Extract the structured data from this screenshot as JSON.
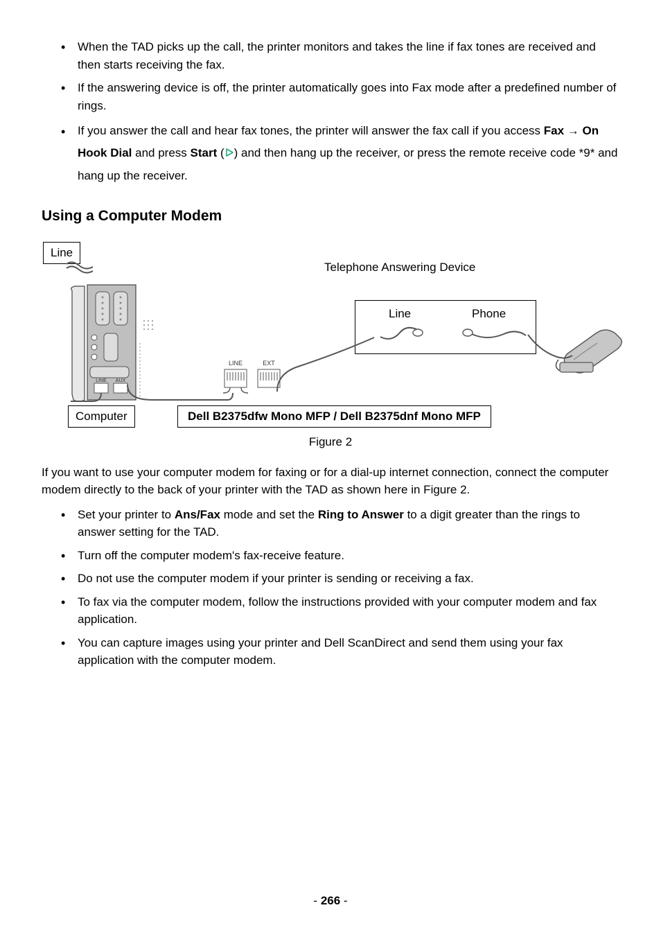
{
  "list1": [
    "When the TAD picks up the call, the printer monitors and takes the line if fax tones are received and then starts receiving the fax.",
    "If the answering device is off, the printer automatically goes into Fax mode after a predefined number of rings."
  ],
  "list1_item3": {
    "pre": "If you answer the call and hear fax tones, the printer will answer the fax call if you access ",
    "fax": "Fax",
    "arrow": " → ",
    "onhook": "On Hook Dial",
    "mid1": " and press ",
    "start": "Start",
    "mid2": " (",
    "mid3": ") and then hang up the receiver, or press the remote receive code *9* and hang up the receiver."
  },
  "heading": "Using a Computer Modem",
  "figure": {
    "line_label": "Line",
    "tad_label": "Telephone Answering Device",
    "tad_line": "Line",
    "tad_phone": "Phone",
    "computer_label": "Computer",
    "printer_label": "Dell B2375dfw Mono MFP / Dell B2375dnf Mono MFP",
    "port_line": "LINE",
    "port_ext": "EXT",
    "card_line": "LINE",
    "card_aux": "AUX",
    "caption": "Figure 2"
  },
  "para": "If you want to use your computer modem for faxing or for a dial-up internet connection, connect the computer modem directly to the back of your printer with the TAD as shown here in Figure 2.",
  "list2_item1": {
    "pre": "Set your printer to ",
    "b1": "Ans/Fax",
    "mid": " mode and set the ",
    "b2": "Ring to Answer",
    "post": " to a digit greater than the rings to answer setting for the TAD."
  },
  "list2_rest": [
    "Turn off the computer modem's fax-receive feature.",
    "Do not use the computer modem if your printer is sending or receiving a fax.",
    "To fax via the computer modem, follow the instructions provided with your computer modem and fax application.",
    "You can capture images using your printer and Dell ScanDirect and send them using your fax application with the computer modem."
  ],
  "page": {
    "dash1": "- ",
    "num": "266",
    "dash2": " -"
  }
}
